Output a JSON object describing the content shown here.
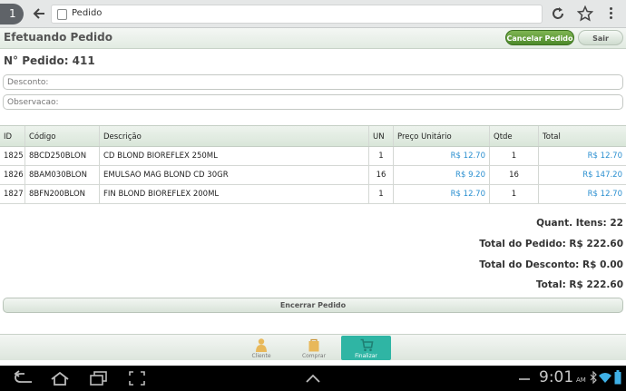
{
  "browser": {
    "tab_count": "1",
    "url_text": "Pedido"
  },
  "header": {
    "title": "Efetuando Pedido",
    "cancel_label": "Cancelar Pedido",
    "exit_label": "Sair"
  },
  "order": {
    "number_label": "N° Pedido: 411",
    "discount_placeholder": "Desconto:",
    "observation_placeholder": "Observacao:"
  },
  "table": {
    "columns": {
      "id": "ID",
      "codigo": "Código",
      "descricao": "Descrição",
      "un": "UN",
      "preco": "Preço Unitário",
      "qtde": "Qtde",
      "total": "Total"
    },
    "rows": [
      {
        "id": "1825",
        "codigo": "8BCD250BLON",
        "descricao": "CD BLOND BIOREFLEX 250ML",
        "un": "1",
        "preco": "R$ 12.70",
        "qtde": "1",
        "total": "R$ 12.70"
      },
      {
        "id": "1826",
        "codigo": "8BAM030BLON",
        "descricao": "EMULSAO MAG BLOND CD 30GR",
        "un": "16",
        "preco": "R$ 9.20",
        "qtde": "16",
        "total": "R$ 147.20"
      },
      {
        "id": "1827",
        "codigo": "8BFN200BLON",
        "descricao": "FIN BLOND BIOREFLEX 200ML",
        "un": "1",
        "preco": "R$ 12.70",
        "qtde": "1",
        "total": "R$ 12.70"
      }
    ]
  },
  "summary": {
    "quant_itens": "Quant. Itens: 22",
    "total_pedido": "Total do Pedido: R$ 222.60",
    "total_desconto": "Total do Desconto: R$ 0.00",
    "total": "Total: R$ 222.60"
  },
  "close_order_label": "Encerrar Pedido",
  "bottom_nav": {
    "cliente": "Cliente",
    "comprar": "Comprar",
    "finalizar": "Finalizar"
  },
  "system_bar": {
    "time": "9:01",
    "ampm": "AM"
  },
  "colors": {
    "accent_green": "#4d8a2b",
    "link_blue": "#2a8fd0",
    "active_tab_teal": "#2fb5a4"
  }
}
